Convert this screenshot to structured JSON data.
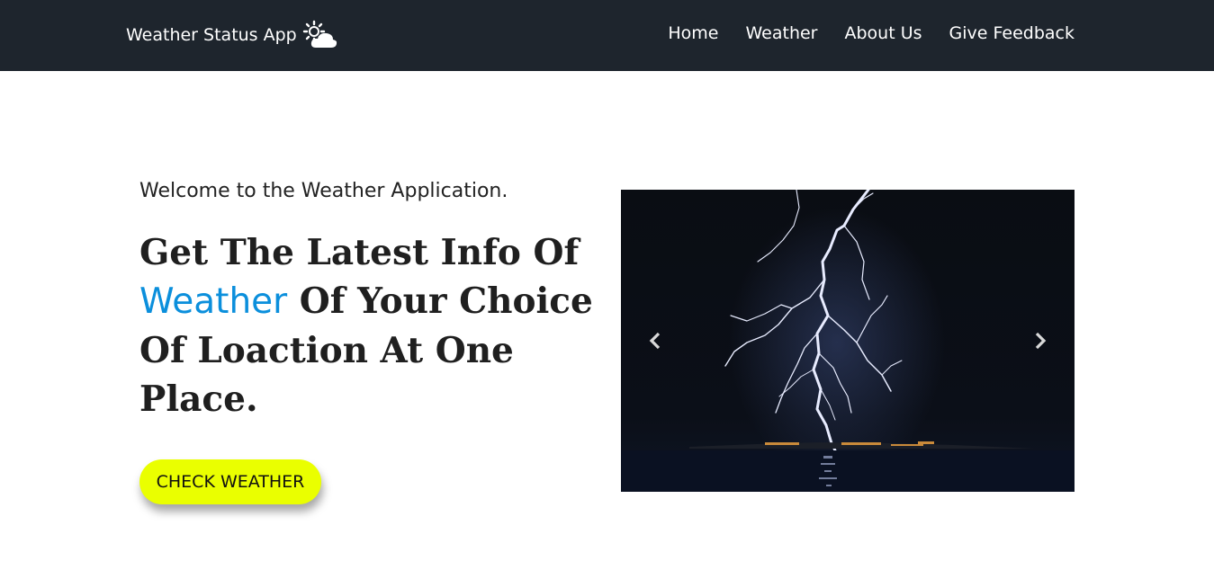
{
  "navbar": {
    "brand_label": "Weather Status App",
    "brand_icon": "sun-cloud-icon",
    "links": [
      {
        "label": "Home"
      },
      {
        "label": "Weather"
      },
      {
        "label": "About Us"
      },
      {
        "label": "Give Feedback"
      }
    ]
  },
  "hero": {
    "welcome": "Welcome to the Weather Application.",
    "headline_part1": "Get The Latest Info Of",
    "headline_accent": "Weather",
    "headline_part2": "Of Your Choice Of Loaction At One Place.",
    "cta_label": "CHECK WEATHER"
  },
  "carousel": {
    "slide_image": "lightning-over-sea",
    "prev_icon": "chevron-left-icon",
    "next_icon": "chevron-right-icon"
  },
  "colors": {
    "navbar_bg": "#1e252d",
    "accent_blue": "#0b8fdc",
    "cta_yellow": "#eaff00",
    "text_dark": "#1f1f1f"
  }
}
